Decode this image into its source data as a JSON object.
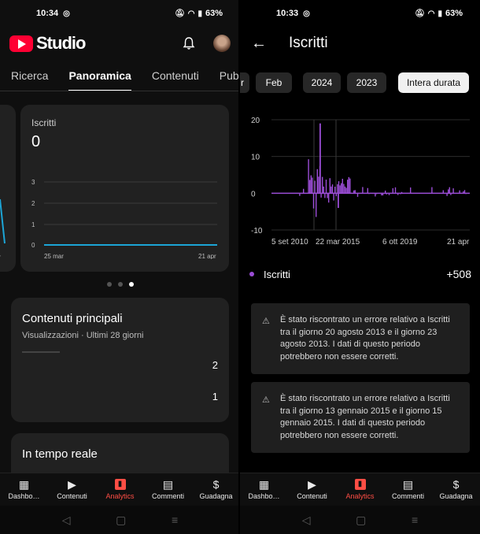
{
  "left": {
    "status": {
      "time": "10:34",
      "battery": "63%"
    },
    "header": {
      "brand": "Studio"
    },
    "tabs": [
      "Ricerca",
      "Panoramica",
      "Contenuti",
      "Pubblico"
    ],
    "subs_card": {
      "label": "Iscritti",
      "value": "0",
      "y_ticks": [
        "3",
        "2",
        "1",
        "0"
      ],
      "x_start": "25 mar",
      "x_end": "21 apr",
      "left_peek_label": "pr"
    },
    "top_content": {
      "title": "Contenuti principali",
      "subtitle": "Visualizzazioni · Ultimi 28 giorni",
      "values": [
        "2",
        "1"
      ]
    },
    "realtime": {
      "title": "In tempo reale"
    }
  },
  "right": {
    "status": {
      "time": "10:33",
      "battery": "63%"
    },
    "header": {
      "title": "Iscritti"
    },
    "chips": [
      "r",
      "Feb",
      "2024",
      "2023",
      "Intera durata"
    ],
    "chart_data": {
      "type": "bar",
      "x_tick_labels": [
        "5 set 2010",
        "22 mar 2015",
        "6 ott 2019",
        "21 apr"
      ],
      "y_ticks": [
        "20",
        "10",
        "0",
        "-10"
      ],
      "ylim": [
        -10,
        20
      ],
      "series": [
        {
          "name": "Iscritti",
          "color": "#9b4dd6",
          "peak": 19,
          "trough": -4
        }
      ]
    },
    "legend": {
      "label": "Iscritti",
      "value": "+508"
    },
    "warnings": [
      "È stato riscontrato un errore relativo a Iscritti tra il giorno 20 agosto 2013 e il giorno 23 agosto 2013. I dati di questo periodo potrebbero non essere corretti.",
      "È stato riscontrato un errore relativo a Iscritti tra il giorno 13 gennaio 2015 e il giorno 15 gennaio 2015. I dati di questo periodo potrebbero non essere corretti."
    ]
  },
  "bottom_nav": [
    {
      "label": "Dashbo…",
      "icon": "dashboard-icon"
    },
    {
      "label": "Contenuti",
      "icon": "content-icon"
    },
    {
      "label": "Analytics",
      "icon": "analytics-icon"
    },
    {
      "label": "Commenti",
      "icon": "comments-icon"
    },
    {
      "label": "Guadagna",
      "icon": "earn-icon"
    }
  ],
  "colors": {
    "accent": "#ff4e45",
    "series": "#9b4dd6",
    "line": "#1ca5d6"
  }
}
